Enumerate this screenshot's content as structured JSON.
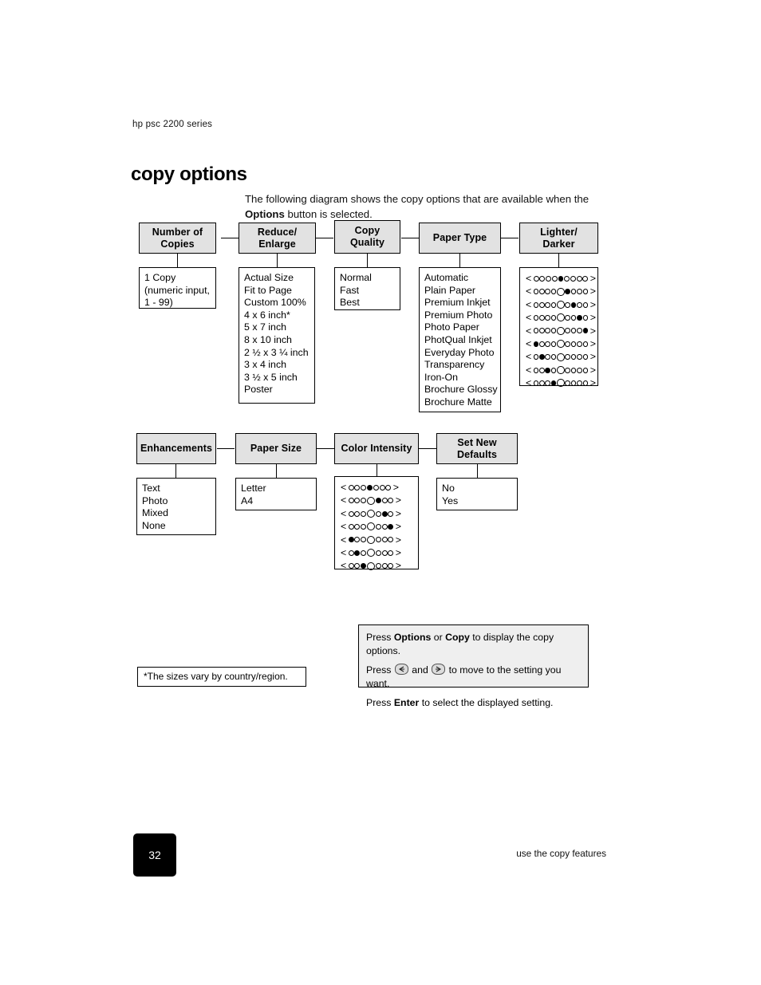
{
  "document": {
    "product_line": "hp psc 2200 series",
    "page_title": "copy options",
    "intro_prefix": "The following diagram shows the copy options that are available when the ",
    "intro_bold": "Options",
    "intro_suffix": " button is selected."
  },
  "diagram": {
    "row1": [
      {
        "header": "Number of\nCopies",
        "header_lines": [
          "Number of",
          "Copies"
        ],
        "items": [
          "1 Copy",
          "(numeric input,",
          "1 - 99)"
        ]
      },
      {
        "header_lines": [
          "Reduce/",
          "Enlarge"
        ],
        "items": [
          "Actual Size",
          "Fit to Page",
          "Custom 100%",
          "4 x 6 inch*",
          "5 x 7 inch",
          "8 x 10 inch",
          "2 ½ x 3 ¼ inch",
          "3 x 4 inch",
          "3 ½ x 5 inch",
          "Poster"
        ]
      },
      {
        "header_lines": [
          "Copy",
          "Quality"
        ],
        "items": [
          "Normal",
          "Fast",
          "Best"
        ]
      },
      {
        "header_lines": [
          "Paper Type"
        ],
        "items": [
          "Automatic",
          "Plain Paper",
          "Premium Inkjet",
          "Premium Photo",
          "Photo Paper",
          "PhotQual Inkjet",
          "Everyday Photo",
          "Transparency",
          "Iron-On",
          "Brochure Glossy",
          "Brochure Matte"
        ]
      },
      {
        "header_lines": [
          "Lighter/",
          "Darker"
        ],
        "scale": {
          "slots": 9,
          "left_chevron": "<",
          "right_chevron": ">",
          "rows": [
            {
              "filled": 5,
              "big": 0
            },
            {
              "filled": 6,
              "big": 5
            },
            {
              "filled": 7,
              "big": 5
            },
            {
              "filled": 8,
              "big": 5
            },
            {
              "filled": 9,
              "big": 5
            },
            {
              "filled": 1,
              "big": 5
            },
            {
              "filled": 2,
              "big": 5
            },
            {
              "filled": 3,
              "big": 5
            },
            {
              "filled": 4,
              "big": 5
            }
          ]
        }
      }
    ],
    "row2": [
      {
        "header_lines": [
          "Enhancements"
        ],
        "items": [
          "Text",
          "Photo",
          "Mixed",
          "None"
        ]
      },
      {
        "header_lines": [
          "Paper Size"
        ],
        "items": [
          "Letter",
          "A4"
        ]
      },
      {
        "header_lines": [
          "Color Intensity"
        ],
        "scale": {
          "slots": 7,
          "left_chevron": "<",
          "right_chevron": ">",
          "rows": [
            {
              "filled": 4,
              "big": 0
            },
            {
              "filled": 5,
              "big": 4
            },
            {
              "filled": 6,
              "big": 4
            },
            {
              "filled": 7,
              "big": 4
            },
            {
              "filled": 1,
              "big": 4
            },
            {
              "filled": 2,
              "big": 4
            },
            {
              "filled": 3,
              "big": 4
            }
          ]
        }
      },
      {
        "header_lines": [
          "Set New",
          "Defaults"
        ],
        "items": [
          "No",
          "Yes"
        ]
      }
    ]
  },
  "footnote": "*The sizes vary by country/region.",
  "tip_box": {
    "line1_a": "Press ",
    "line1_b": "Options",
    "line1_c": " or ",
    "line1_d": "Copy",
    "line1_e": " to display the copy options.",
    "line2_a": "Press ",
    "line2_b": " and ",
    "line2_c": " to move to the setting you want.",
    "line3_a": "Press ",
    "line3_b": "Enter",
    "line3_c": " to select the displayed setting.",
    "left_arrow_icon": "left-arrow-button-icon",
    "right_arrow_icon": "right-arrow-button-icon"
  },
  "footer": {
    "page_number": "32",
    "caption": "use the copy features"
  },
  "colors": {
    "header_fill": "#e2e2e2",
    "tip_fill": "#efefef",
    "stroke": "#000000",
    "page_number_fill": "#000000"
  }
}
